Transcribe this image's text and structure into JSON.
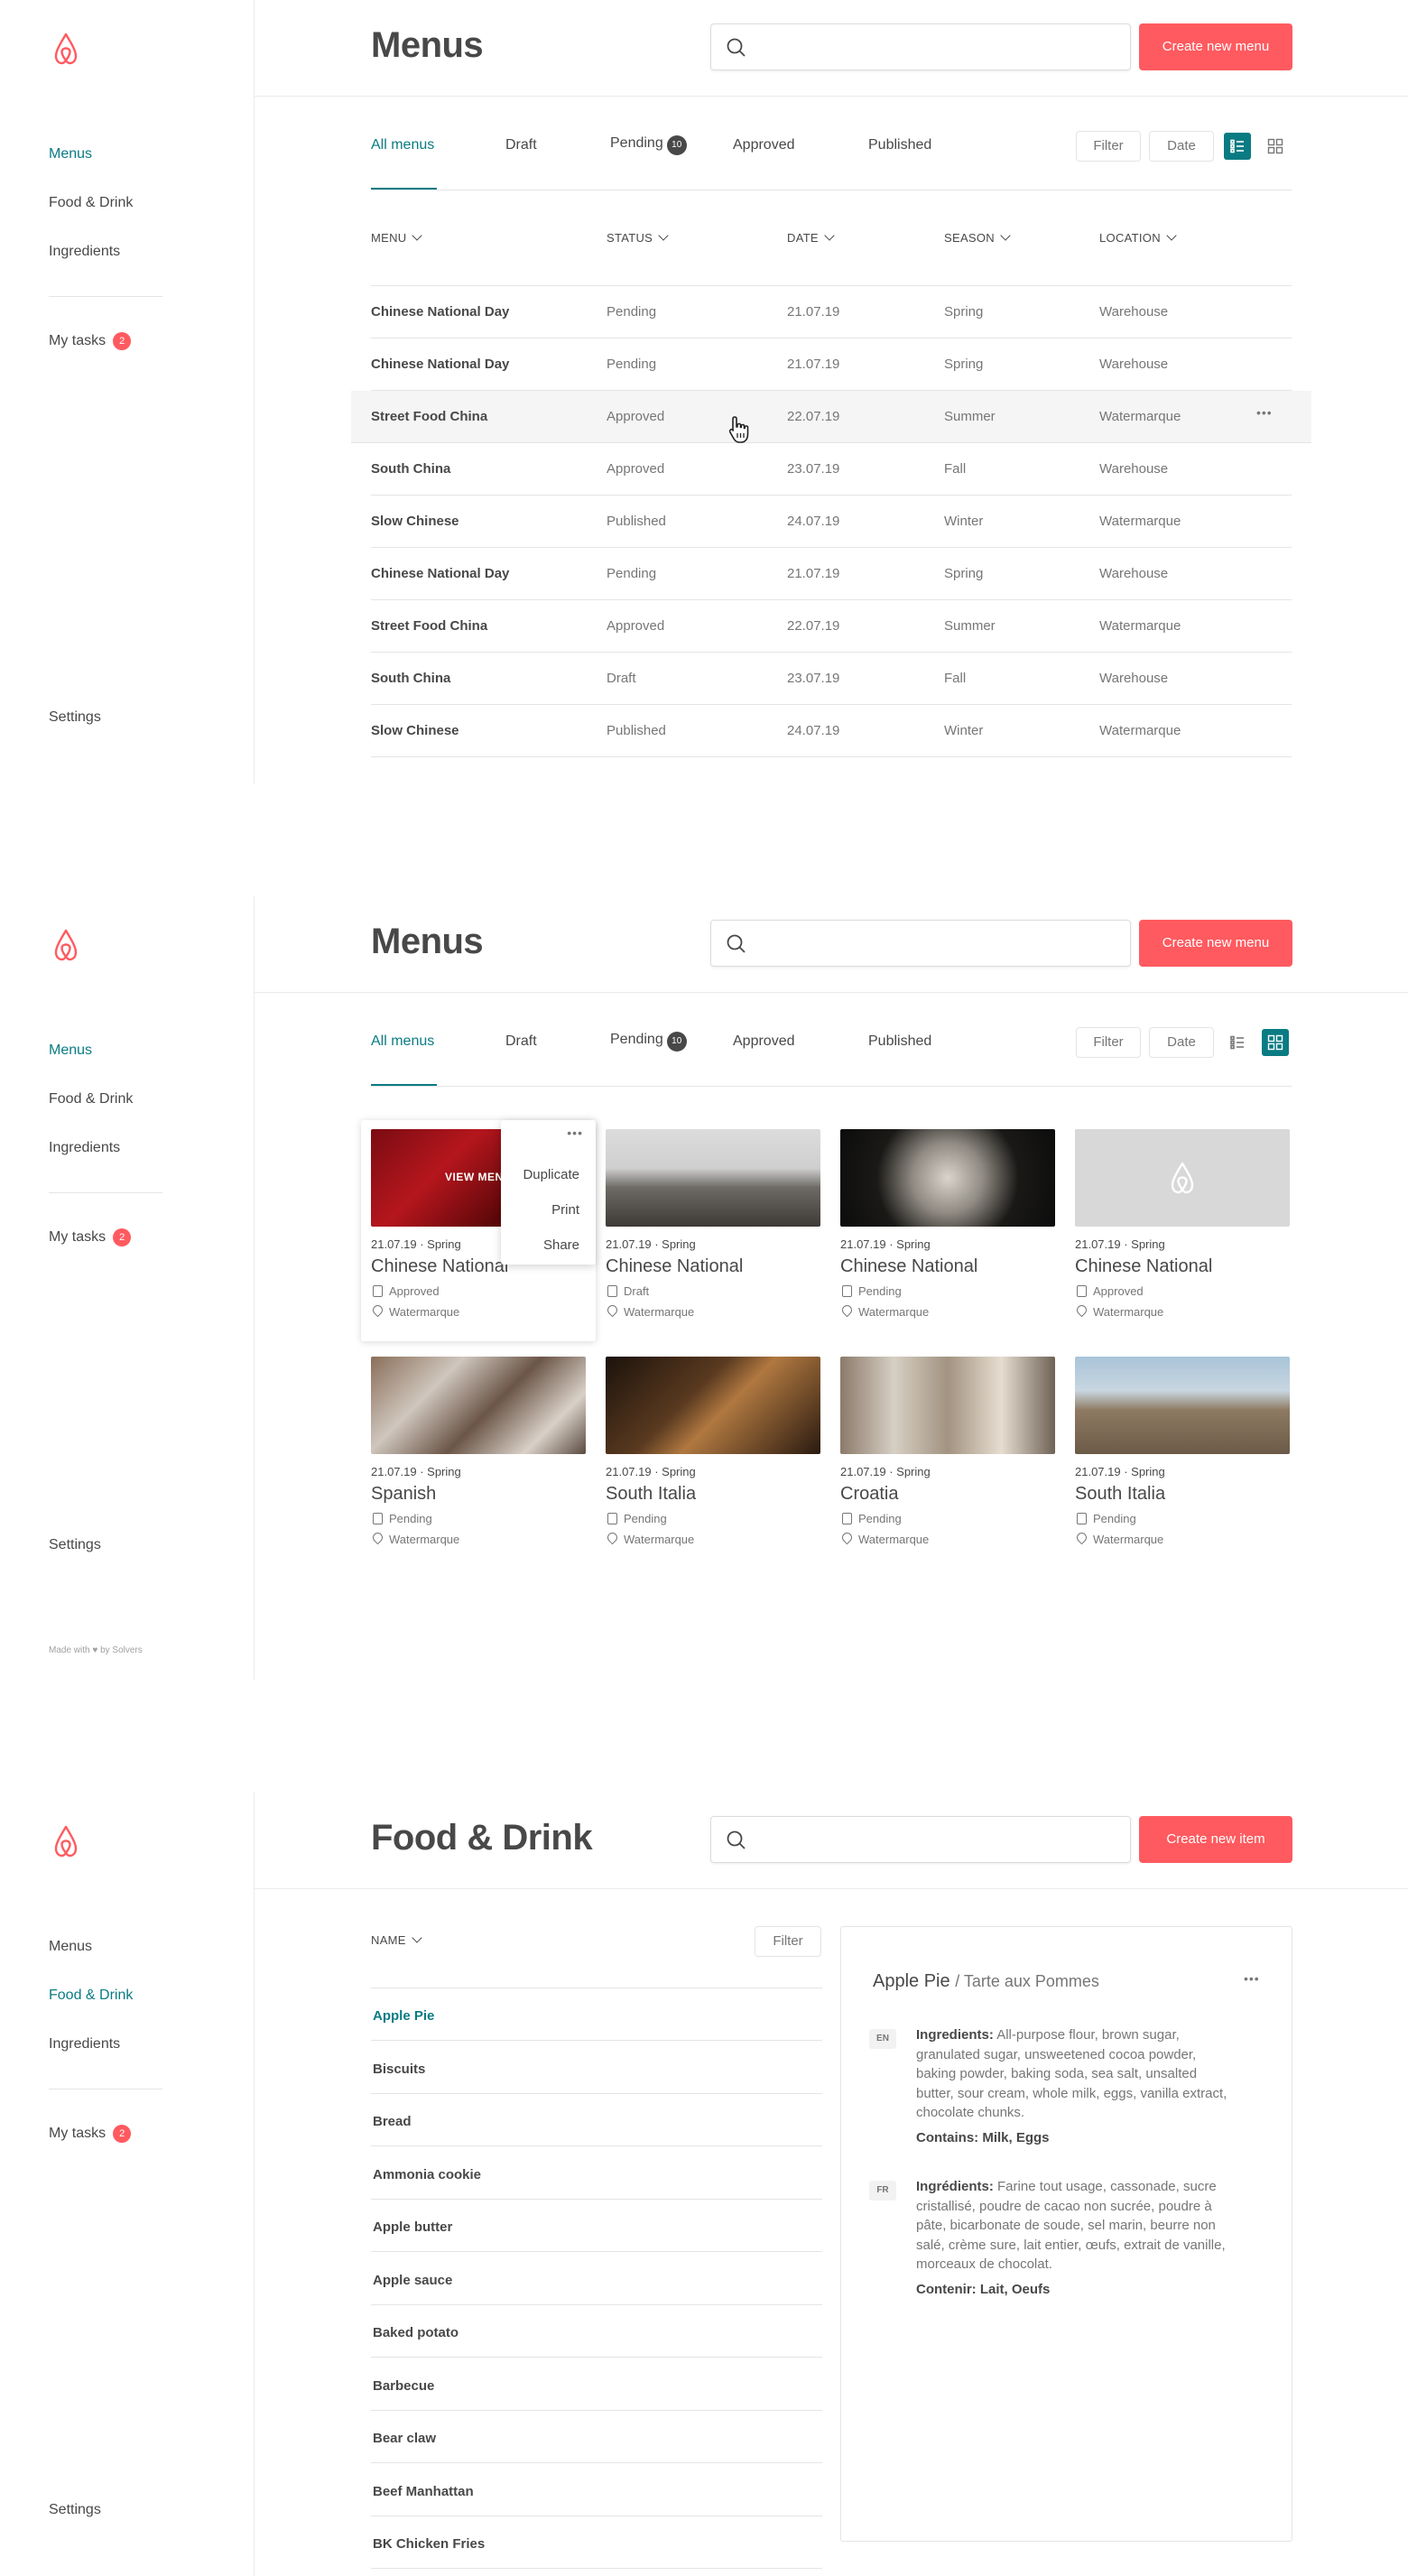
{
  "colors": {
    "accent": "#0a7b83",
    "brand": "#ff5a5f",
    "text": "#484848"
  },
  "nav": {
    "menus": "Menus",
    "food": "Food & Drink",
    "ingredients": "Ingredients",
    "tasks": "My tasks",
    "tasks_count": "2",
    "settings": "Settings"
  },
  "screen1": {
    "title": "Menus",
    "create_label": "Create new menu",
    "tabs": [
      "All menus",
      "Draft",
      "Pending",
      "Approved",
      "Published"
    ],
    "pending_count": "10",
    "filter_label": "Filter",
    "date_label": "Date",
    "columns": [
      "MENU",
      "STATUS",
      "DATE",
      "SEASON",
      "LOCATION"
    ],
    "rows": [
      {
        "menu": "Chinese National Day",
        "status": "Pending",
        "date": "21.07.19",
        "season": "Spring",
        "location": "Warehouse"
      },
      {
        "menu": "Chinese National Day",
        "status": "Pending",
        "date": "21.07.19",
        "season": "Spring",
        "location": "Warehouse"
      },
      {
        "menu": "Street Food China",
        "status": "Approved",
        "date": "22.07.19",
        "season": "Summer",
        "location": "Watermarque"
      },
      {
        "menu": "South China",
        "status": "Approved",
        "date": "23.07.19",
        "season": "Fall",
        "location": "Warehouse"
      },
      {
        "menu": "Slow Chinese",
        "status": "Published",
        "date": "24.07.19",
        "season": "Winter",
        "location": "Watermarque"
      },
      {
        "menu": "Chinese National Day",
        "status": "Pending",
        "date": "21.07.19",
        "season": "Spring",
        "location": "Warehouse"
      },
      {
        "menu": "Street Food China",
        "status": "Approved",
        "date": "22.07.19",
        "season": "Summer",
        "location": "Watermarque"
      },
      {
        "menu": "South China",
        "status": "Draft",
        "date": "23.07.19",
        "season": "Fall",
        "location": "Warehouse"
      },
      {
        "menu": "Slow Chinese",
        "status": "Published",
        "date": "24.07.19",
        "season": "Winter",
        "location": "Watermarque"
      }
    ],
    "more_label": "•••"
  },
  "screen2": {
    "title": "Menus",
    "create_label": "Create new menu",
    "tabs": [
      "All menus",
      "Draft",
      "Pending",
      "Approved",
      "Published"
    ],
    "pending_count": "10",
    "filter_label": "Filter",
    "date_label": "Date",
    "view_label": "VIEW MENU",
    "context_menu": [
      "Duplicate",
      "Print",
      "Share"
    ],
    "cards": [
      {
        "meta": "21.07.19 · Spring",
        "name": "Chinese National",
        "status": "Approved",
        "location": "Watermarque"
      },
      {
        "meta": "21.07.19 · Spring",
        "name": "Chinese National",
        "status": "Draft",
        "location": "Watermarque"
      },
      {
        "meta": "21.07.19 · Spring",
        "name": "Chinese National",
        "status": "Pending",
        "location": "Watermarque"
      },
      {
        "meta": "21.07.19 · Spring",
        "name": "Chinese National",
        "status": "Approved",
        "location": "Watermarque"
      },
      {
        "meta": "21.07.19 · Spring",
        "name": "Spanish",
        "status": "Pending",
        "location": "Watermarque"
      },
      {
        "meta": "21.07.19 · Spring",
        "name": "South Italia",
        "status": "Pending",
        "location": "Watermarque"
      },
      {
        "meta": "21.07.19 · Spring",
        "name": "Croatia",
        "status": "Pending",
        "location": "Watermarque"
      },
      {
        "meta": "21.07.19 · Spring",
        "name": "South Italia",
        "status": "Pending",
        "location": "Watermarque"
      }
    ],
    "made_with": "Made with ♥ by Solvers"
  },
  "screen3": {
    "title": "Food & Drink",
    "create_label": "Create new item",
    "name_col": "NAME",
    "filter_label": "Filter",
    "items": [
      "Apple Pie",
      "Biscuits",
      "Bread",
      "Ammonia cookie",
      "Apple butter",
      "Apple sauce",
      "Baked potato",
      "Barbecue",
      "Bear claw",
      "Beef Manhattan",
      "BK Chicken Fries"
    ],
    "detail": {
      "name": "Apple Pie",
      "alt_name": "/ Tarte aux Pommes",
      "en_tag": "EN",
      "en_label": "Ingredients:",
      "en_text": "All-purpose flour, brown sugar, granulated sugar, unsweetened cocoa powder, baking powder, baking soda, sea salt, unsalted butter, sour cream, whole milk, eggs, vanilla extract, chocolate chunks.",
      "en_contains": "Contains: Milk, Eggs",
      "fr_tag": "FR",
      "fr_label": "Ingrédients:",
      "fr_text": "Farine tout usage, cassonade, sucre cristallisé, poudre de cacao non sucrée, poudre à pâte, bicarbonate de soude, sel marin, beurre non salé, crème sure, lait entier, œufs, extrait de vanille, morceaux de chocolat.",
      "fr_contains": "Contenir: Lait, Oeufs"
    }
  }
}
